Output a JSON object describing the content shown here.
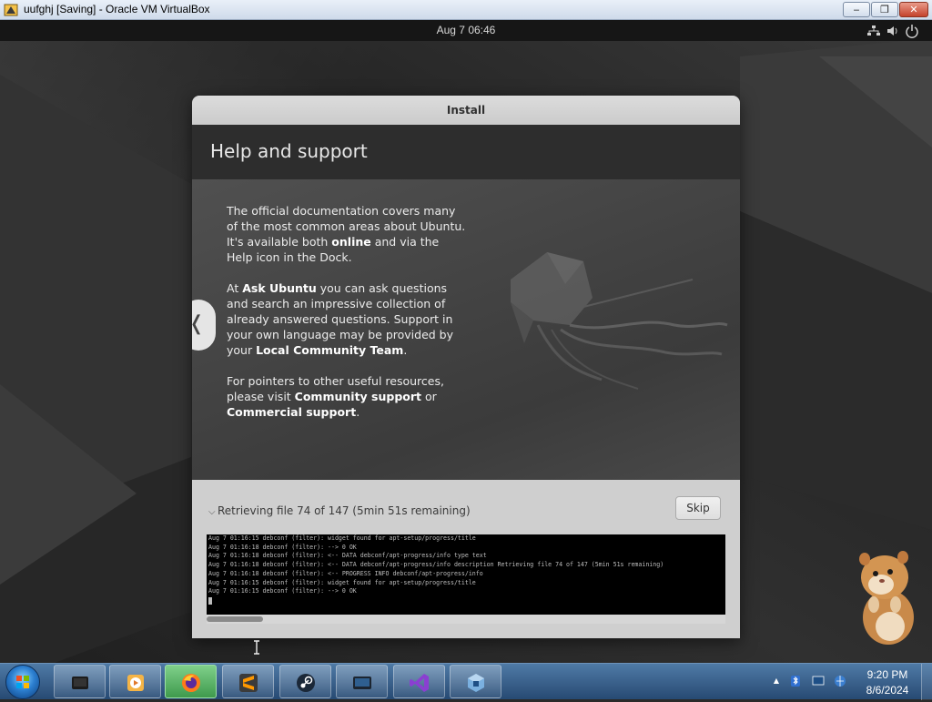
{
  "host_window": {
    "title": "uufghj [Saving] - Oracle VM VirtualBox",
    "minimize_glyph": "‒",
    "maximize_glyph": "❐",
    "close_glyph": "✕"
  },
  "guest_topbar": {
    "clock": "Aug 7  06:46",
    "tray_icons": [
      "network-icon",
      "volume-icon",
      "power-icon"
    ]
  },
  "installer": {
    "window_title": "Install",
    "slide_title": "Help and support",
    "paragraphs": [
      [
        {
          "t": "The official documentation covers many of the most common areas about Ubuntu. It's available both "
        },
        {
          "t": "online",
          "b": true
        },
        {
          "t": " and via the Help icon in the Dock."
        }
      ],
      [
        {
          "t": "At "
        },
        {
          "t": "Ask Ubuntu",
          "b": true
        },
        {
          "t": " you can ask questions and search an impressive collection of already answered questions. Support in your own language may be provided by your "
        },
        {
          "t": "Local Community Team",
          "b": true
        },
        {
          "t": "."
        }
      ],
      [
        {
          "t": "For pointers to other useful resources, please visit "
        },
        {
          "t": "Community support",
          "b": true
        },
        {
          "t": " or "
        },
        {
          "t": "Commercial support",
          "b": true
        },
        {
          "t": "."
        }
      ]
    ],
    "prev_glyph": "❬",
    "progress_text": "Retrieving file 74 of 147 (5min 51s remaining)",
    "skip_label": "Skip",
    "terminal_lines": [
      "Aug  7 01:16:15 debconf (filter): widget found for apt-setup/progress/title",
      "Aug  7 01:16:18 debconf (filter): --> 0 OK",
      "Aug  7 01:16:18 debconf (filter): <-- DATA debconf/apt-progress/info type text",
      "Aug  7 01:16:18 debconf (filter): <-- DATA debconf/apt-progress/info description Retrieving file 74 of 147 (5min 51s remaining)",
      "Aug  7 01:16:18 debconf (filter): <-- PROGRESS INFO debconf/apt-progress/info",
      "Aug  7 01:16:15 debconf (filter): widget found for apt-setup/progress/title",
      "Aug  7 01:16:15 debconf (filter): --> 0 OK"
    ]
  },
  "taskbar": {
    "pinned": [
      {
        "name": "taskbar-app-virtualbox-vm"
      },
      {
        "name": "taskbar-app-media-player"
      },
      {
        "name": "taskbar-app-firefox"
      },
      {
        "name": "taskbar-app-sublime"
      },
      {
        "name": "taskbar-app-steam"
      },
      {
        "name": "taskbar-app-remote-display"
      },
      {
        "name": "taskbar-app-visual-studio"
      },
      {
        "name": "taskbar-app-virtualbox-manager"
      }
    ],
    "tray_expand_glyph": "▲",
    "time": "9:20 PM",
    "date": "8/6/2024"
  }
}
